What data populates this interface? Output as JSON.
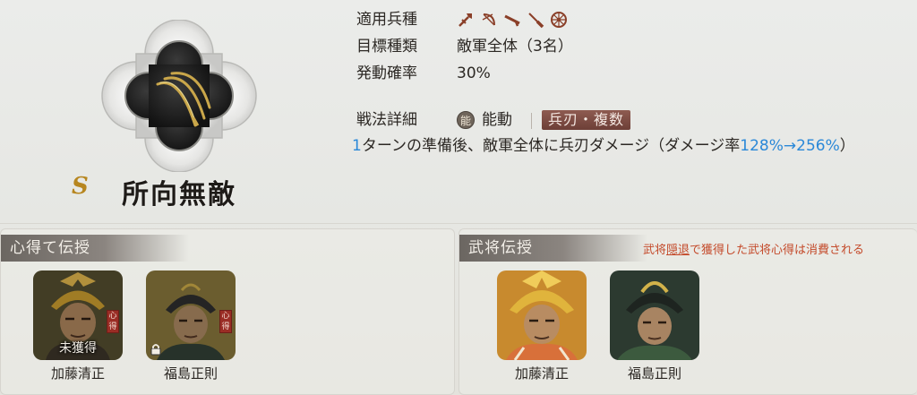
{
  "skill": {
    "rank": "S",
    "name": "所向無敵",
    "icon": "katana-emblem-icon"
  },
  "info": {
    "troop_label": "適用兵種",
    "troop_icons": [
      "spear-icon",
      "bow-icon",
      "gun-icon",
      "blade-icon",
      "cart-wheel-icon"
    ],
    "target_label": "目標種類",
    "target_value": "敵軍全体（3名）",
    "rate_label": "発動確率",
    "rate_value": "30%",
    "detail_label": "戦法詳細",
    "ability_badge": "能",
    "ability_type": "能動",
    "damage_tag": "兵刃・複数",
    "desc_prefix_num": "1",
    "desc_main": "ターンの準備後、敵軍全体に兵刃ダメージ（ダメージ率",
    "desc_rate": "128%→256%",
    "desc_suffix": "）"
  },
  "panels": {
    "left": {
      "title": "心得て伝授",
      "cards": [
        {
          "name": "加藤清正",
          "status": "未獲得",
          "seal": "心得"
        },
        {
          "name": "福島正則",
          "seal": "心得"
        }
      ]
    },
    "right": {
      "title": "武将伝授",
      "note_pre": "武将",
      "note_link": "隠退",
      "note_post": "で獲得した武将心得は消費される",
      "cards": [
        {
          "name": "加藤清正"
        },
        {
          "name": "福島正則"
        }
      ]
    }
  },
  "colors": {
    "accent_blue": "#2a88d8",
    "tag_red": "#7a463d",
    "note_red": "#c44a2a",
    "rank_gold": "#b7861f"
  }
}
